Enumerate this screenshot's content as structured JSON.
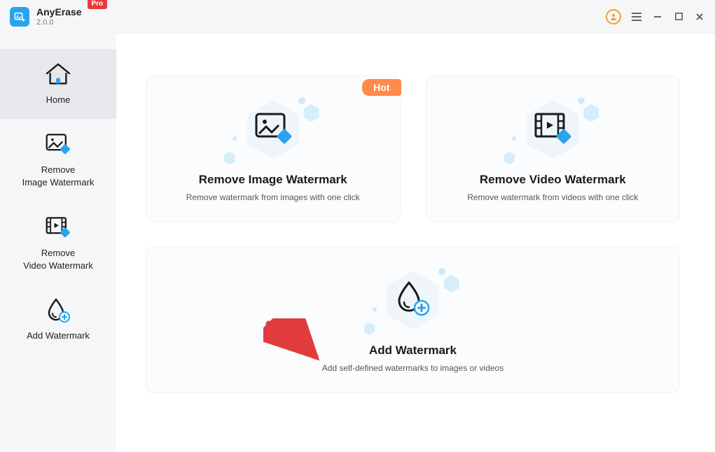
{
  "app": {
    "name": "AnyErase",
    "version": "2.0.0",
    "badge": "Pro"
  },
  "sidebar": {
    "items": [
      {
        "label": "Home"
      },
      {
        "label": "Remove\nImage Watermark"
      },
      {
        "label": "Remove\nVideo Watermark"
      },
      {
        "label": "Add Watermark"
      }
    ]
  },
  "cards": {
    "removeImage": {
      "title": "Remove Image Watermark",
      "sub": "Remove watermark from images with one click",
      "tag": "Hot"
    },
    "removeVideo": {
      "title": "Remove Video Watermark",
      "sub": "Remove watermark from videos with one click"
    },
    "addWatermark": {
      "title": "Add Watermark",
      "sub": "Add self-defined watermarks to images or videos"
    }
  }
}
